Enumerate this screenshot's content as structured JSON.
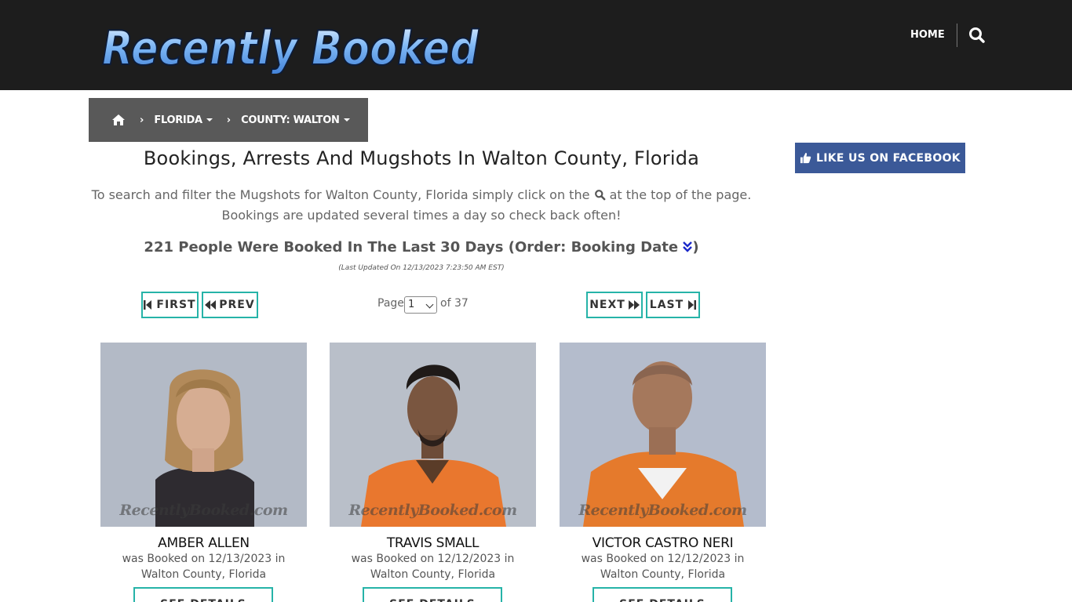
{
  "header": {
    "logo_text": "Recently Booked",
    "nav_home": "HOME"
  },
  "breadcrumb": {
    "state": "FLORIDA",
    "county": "COUNTY: WALTON"
  },
  "facebook": {
    "label": "LIKE US ON FACEBOOK",
    "color": "#3b5998"
  },
  "main": {
    "title": "Bookings, Arrests And Mugshots In Walton County, Florida",
    "desc_before_icon": "To search and filter the Mugshots for Walton County, Florida simply click on the",
    "desc_after_icon": "at the top of the page.",
    "desc_line2": "Bookings are updated several times a day so check back often!",
    "count_text": "221 People Were Booked In The Last 30 Days (Order: Booking Date",
    "count_close": ")",
    "last_updated": "(Last Updated On 12/13/2023 7:23:50 AM EST)"
  },
  "pager": {
    "first": "FIRST",
    "prev": "PREV",
    "next": "NEXT",
    "last": "LAST",
    "page_label": "Page",
    "current_page": "1",
    "of_label": "of 37",
    "accent": "#26b3a8"
  },
  "watermark": "RecentlyBooked.com",
  "people": [
    {
      "name": "AMBER ALLEN",
      "booked": "was Booked on 12/13/2023 in",
      "location": "Walton County, Florida",
      "button": "SEE DETAILS"
    },
    {
      "name": "TRAVIS SMALL",
      "booked": "was Booked on 12/12/2023 in",
      "location": "Walton County, Florida",
      "button": "SEE DETAILS"
    },
    {
      "name": "VICTOR CASTRO NERI",
      "booked": "was Booked on 12/12/2023 in",
      "location": "Walton County, Florida",
      "button": "SEE DETAILS"
    }
  ]
}
